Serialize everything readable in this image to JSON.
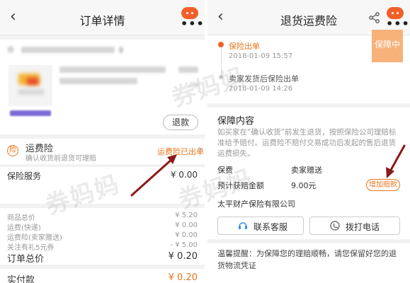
{
  "left": {
    "title": "订单详情",
    "refund_label": "退款",
    "insurance": {
      "icon_char": "险",
      "name": "运费险",
      "desc": "确认收货前退货可理赔",
      "status": "运费险已出单",
      "chevron": "›"
    },
    "service": {
      "label": "保险服务",
      "value": "¥ 0.00"
    },
    "price_rows": [
      {
        "label": "商品总价",
        "value": "¥ 5.20"
      },
      {
        "label": "运费(快递)",
        "value": "¥ 0.00"
      },
      {
        "label": "运费险(卖家赠送)",
        "value": "¥ 0.00"
      },
      {
        "label": "关注有礼5元券",
        "value": "- ¥ 5.00"
      }
    ],
    "total": {
      "label": "订单总价",
      "value": "¥ 0.20"
    },
    "paid": {
      "label": "实付款",
      "value": "¥ 0.20"
    }
  },
  "right": {
    "title": "退货运费险",
    "corner_badge": "保障中",
    "timeline": [
      {
        "text": "保险出单",
        "time": "2018-01-09 15:57",
        "active": true
      },
      {
        "text": "卖家发货后保险出单",
        "time": "2018-01-09 14:26",
        "active": false
      }
    ],
    "coverage": {
      "heading": "保障内容",
      "body": "如买家在“确认收货”前发生退货，按照保险公司理赔标准给予赔付。运费险不赔付交易成功后发起的售后退货运费损失。",
      "col1": "保费",
      "col2": "卖家赠送",
      "claim_label": "预计获赔金额",
      "claim_value": "9.00元",
      "increase_btn": "增加赔款"
    },
    "insurer": "太平财产保险有限公司",
    "contact_insurer": "联系客服",
    "call_phone": "拨打电话",
    "tip": "温馨提醒：为保障您的理赔顺畅，请您保留好您的退货物流凭证"
  },
  "watermark": "券妈妈",
  "colors": {
    "orange": "#e8771e",
    "accent": "#f2602a",
    "arrow": "#8b1a1a"
  }
}
